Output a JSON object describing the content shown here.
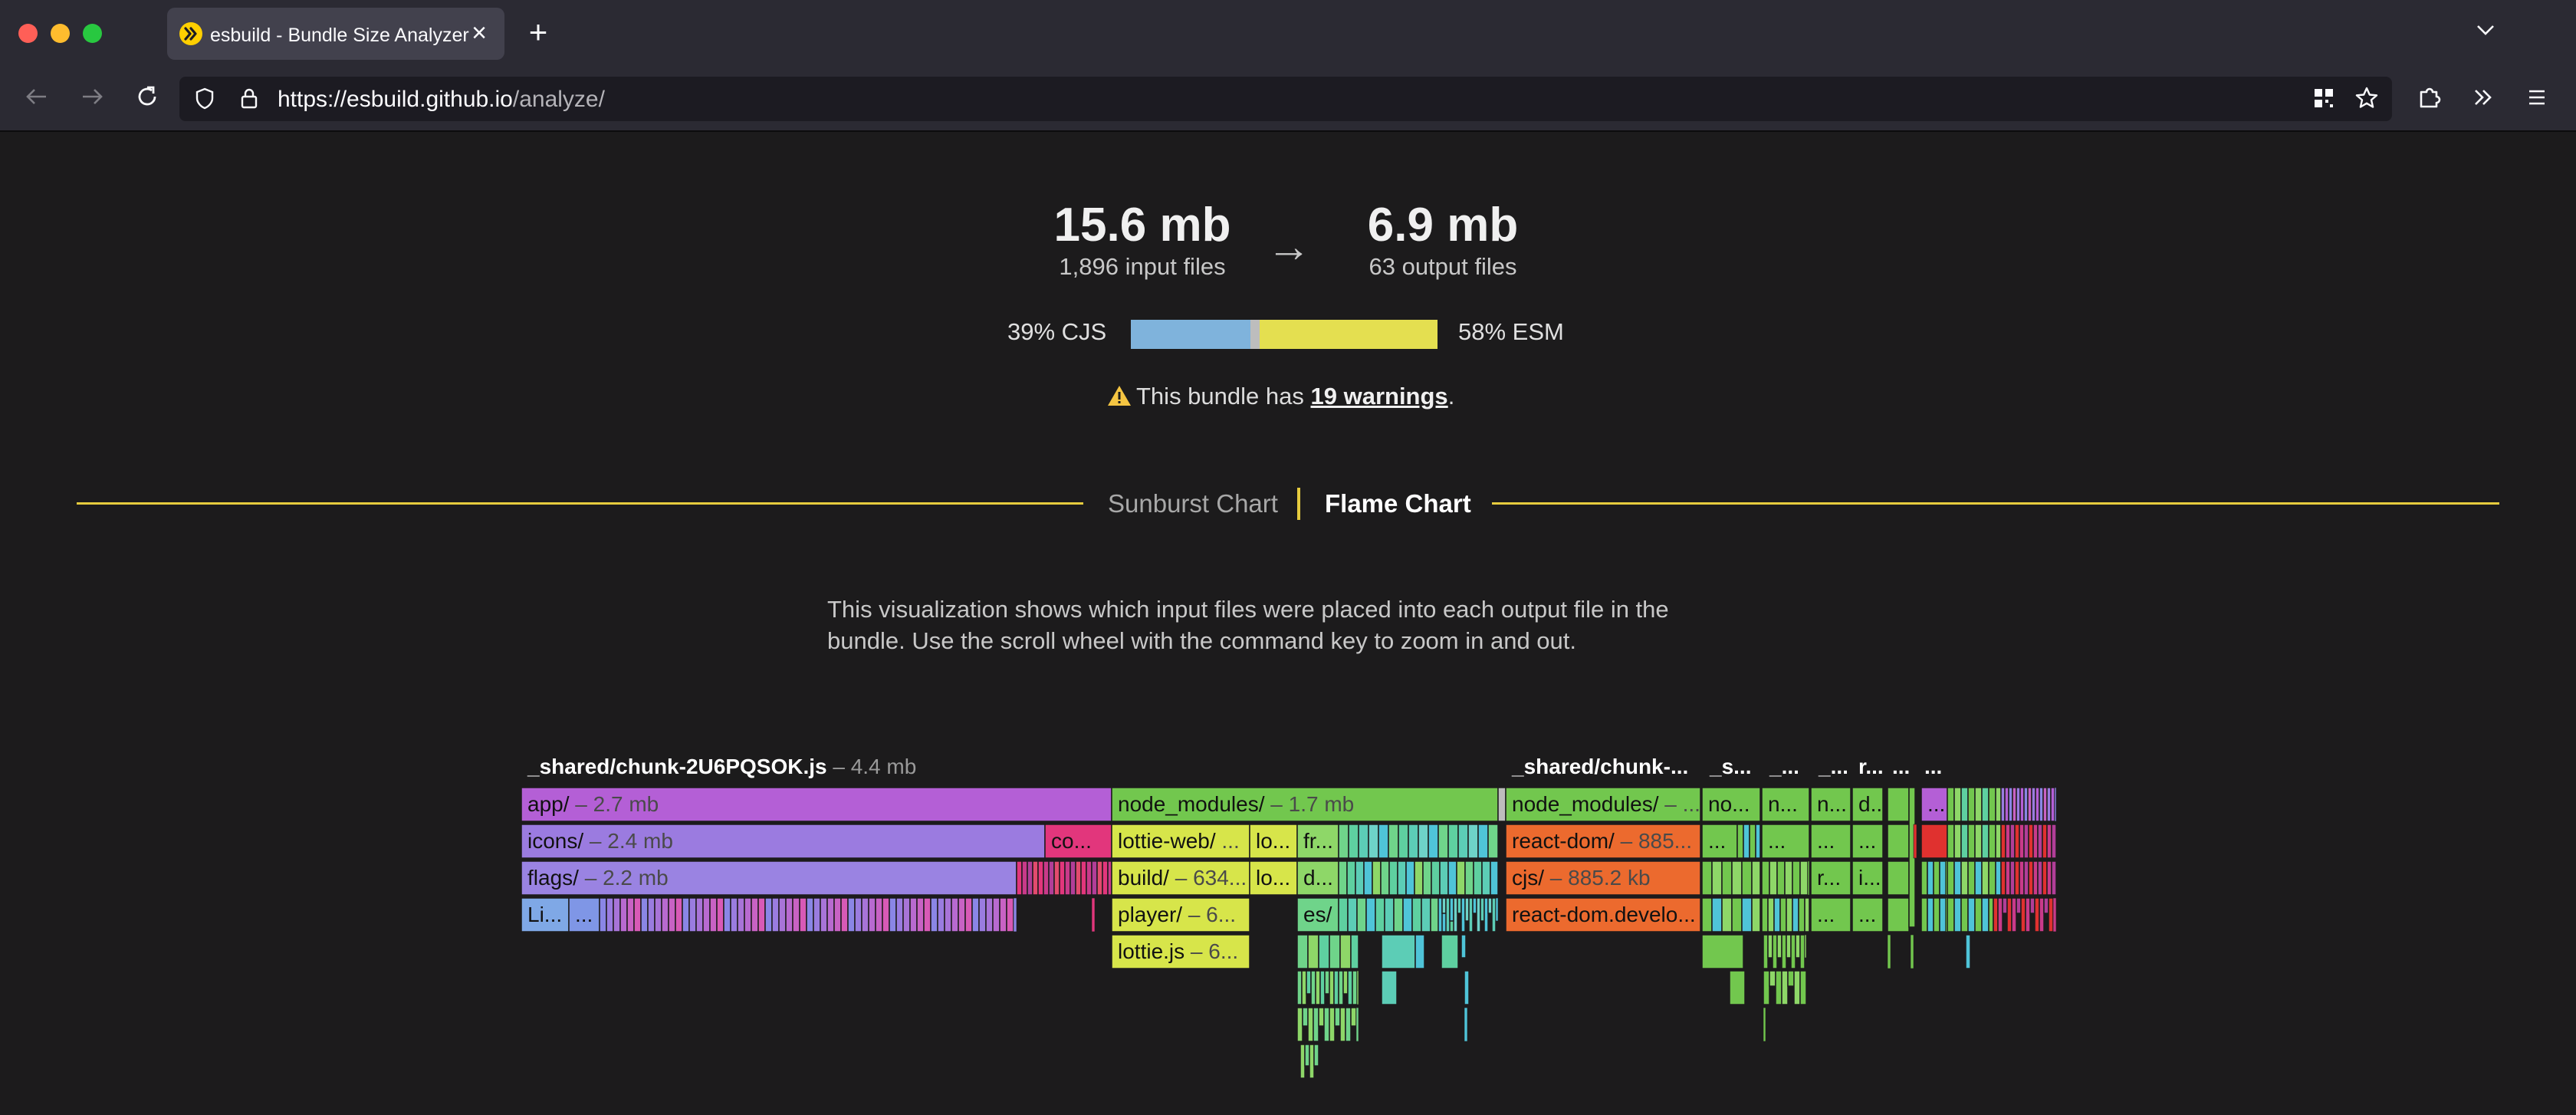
{
  "browser": {
    "tab_title": "esbuild - Bundle Size Analyzer",
    "url_host": "https://esbuild.github.io",
    "url_path": "/analyze/"
  },
  "summary": {
    "input_size": "15.6 mb",
    "input_files": "1,896 input files",
    "output_size": "6.9 mb",
    "output_files": "63 output files",
    "cjs_label": "39% CJS",
    "esm_label": "58% ESM",
    "cjs_fraction": 0.39,
    "other_fraction": 0.03,
    "esm_fraction": 0.58,
    "warning_prefix": "This bundle has",
    "warning_link": "19 warnings",
    "warning_suffix": "."
  },
  "chart_tabs": {
    "sunburst": "Sunburst Chart",
    "flame": "Flame Chart"
  },
  "description": "This visualization shows which input files were placed into each output file in the bundle. Use the scroll wheel with the command key to zoom in and out.",
  "flame": {
    "headers": [
      {
        "name": "_shared/chunk-2U6PQSOK.js",
        "size": "– 4.4 mb"
      },
      {
        "name": "_shared/chunk-...",
        "size": ""
      },
      {
        "name": "_s...",
        "size": ""
      },
      {
        "name": "_...",
        "size": ""
      },
      {
        "name": "_...",
        "size": ""
      },
      {
        "name": "r...",
        "size": ""
      },
      {
        "name": "...",
        "size": ""
      },
      {
        "name": "...",
        "size": ""
      }
    ],
    "labeled_boxes": [
      {
        "name": "app/",
        "size": "– 2.7 mb",
        "color": "#b45fd6"
      },
      {
        "name": "icons/",
        "size": "– 2.4 mb",
        "color": "#9b7be0"
      },
      {
        "name": "co...",
        "size": "",
        "color": "#e2367c"
      },
      {
        "name": "flags/",
        "size": "– 2.2 mb",
        "color": "#9a83e2"
      },
      {
        "name": "Li...",
        "size": "",
        "color": "#7fa8e6"
      },
      {
        "name": "...",
        "size": "",
        "color": "#7f96e6"
      },
      {
        "name": "node_modules/",
        "size": "– 1.7 mb",
        "color": "#72c74e"
      },
      {
        "name": "lottie-web/",
        "size": "...",
        "color": "#d7e54a"
      },
      {
        "name": "lo...",
        "size": "",
        "color": "#d7e54a"
      },
      {
        "name": "fr...",
        "size": "",
        "color": "#8ed768"
      },
      {
        "name": "build/",
        "size": "– 634...",
        "color": "#d7e54a"
      },
      {
        "name": "lo...",
        "size": "",
        "color": "#d7e54a"
      },
      {
        "name": "d...",
        "size": "",
        "color": "#8ed768"
      },
      {
        "name": "player/",
        "size": "– 6...",
        "color": "#d7e54a"
      },
      {
        "name": "es/",
        "size": "",
        "color": "#6fd48a"
      },
      {
        "name": "lottie.js",
        "size": "– 6...",
        "color": "#d7e54a"
      },
      {
        "name": "node_modules/",
        "size": "– ...",
        "color": "#72c74e"
      },
      {
        "name": "react-dom/",
        "size": "– 885...",
        "color": "#ec6a2e"
      },
      {
        "name": "cjs/",
        "size": "– 885.2 kb",
        "color": "#ec6a2e"
      },
      {
        "name": "react-dom.develo...",
        "size": "",
        "color": "#ec6a2e"
      },
      {
        "name": "no...",
        "size": "",
        "color": "#72c74e"
      },
      {
        "name": "...",
        "size": "",
        "color": "#72c74e"
      },
      {
        "name": "n...",
        "size": "",
        "color": "#72c74e"
      },
      {
        "name": "...",
        "size": "",
        "color": "#72c74e"
      },
      {
        "name": "n...",
        "size": "",
        "color": "#72c74e"
      },
      {
        "name": "...",
        "size": "",
        "color": "#72c74e"
      },
      {
        "name": "r...",
        "size": "",
        "color": "#72c74e"
      },
      {
        "name": "...",
        "size": "",
        "color": "#72c74e"
      },
      {
        "name": "d...",
        "size": "",
        "color": "#72c74e"
      },
      {
        "name": "...",
        "size": "",
        "color": "#72c74e"
      },
      {
        "name": "i...",
        "size": "",
        "color": "#72c74e"
      },
      {
        "name": "...",
        "size": "",
        "color": "#72c74e"
      },
      {
        "name": "...",
        "size": "",
        "color": "#b45fd6"
      }
    ]
  },
  "colors": {
    "cjs": "#7fb3dc",
    "other": "#bdbdbd",
    "esm": "#e4df50",
    "accent": "#e6cb3e",
    "warning": "#f5c542"
  }
}
